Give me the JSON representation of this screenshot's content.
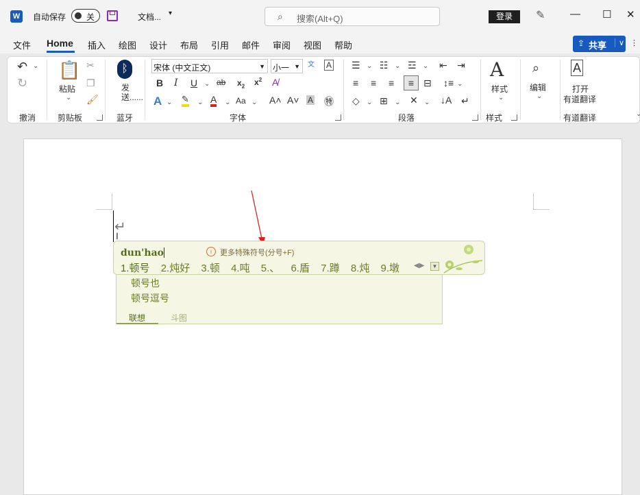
{
  "titlebar": {
    "autosave_label": "自动保存",
    "autosave_state": "关",
    "doc_name": "文档...",
    "search_placeholder": "搜索(Alt+Q)",
    "login_label": "登录",
    "minimize": "—",
    "maximize": "☐",
    "close": "✕"
  },
  "tabs": [
    "文件",
    "Home",
    "插入",
    "绘图",
    "设计",
    "布局",
    "引用",
    "邮件",
    "审阅",
    "视图",
    "帮助"
  ],
  "share_label": "共享",
  "ribbon": {
    "undo_group": "撤消",
    "clipboard_group": "剪贴板",
    "paste_label": "粘贴",
    "bluetooth_label": "发送......",
    "bluetooth_group": "蓝牙",
    "font_name": "宋体 (中文正文)",
    "font_size": "小一",
    "font_group": "字体",
    "paragraph_group": "段落",
    "styles_label": "样式",
    "styles_group": "样式",
    "editing_label": "编辑",
    "youdao_label_1": "打开",
    "youdao_label_2": "有道翻译",
    "youdao_group": "有道翻译"
  },
  "ime": {
    "pinyin": "dun'hao",
    "tip": "更多特殊符号(分号+F)",
    "candidates": [
      "1.顿号",
      "2.炖好",
      "3.顿",
      "4.吨",
      "5.、",
      "6.盾",
      "7.蹲",
      "8.炖",
      "9.墩"
    ],
    "associations": [
      "顿号也",
      "顿号逗号"
    ],
    "tab_assoc": "联想",
    "tab_emoji": "斗图"
  },
  "colors": {
    "accent": "#185abd",
    "ime_text": "#6b7a2a",
    "ime_bg": "#f5f7e4",
    "arrow": "#e02020"
  }
}
